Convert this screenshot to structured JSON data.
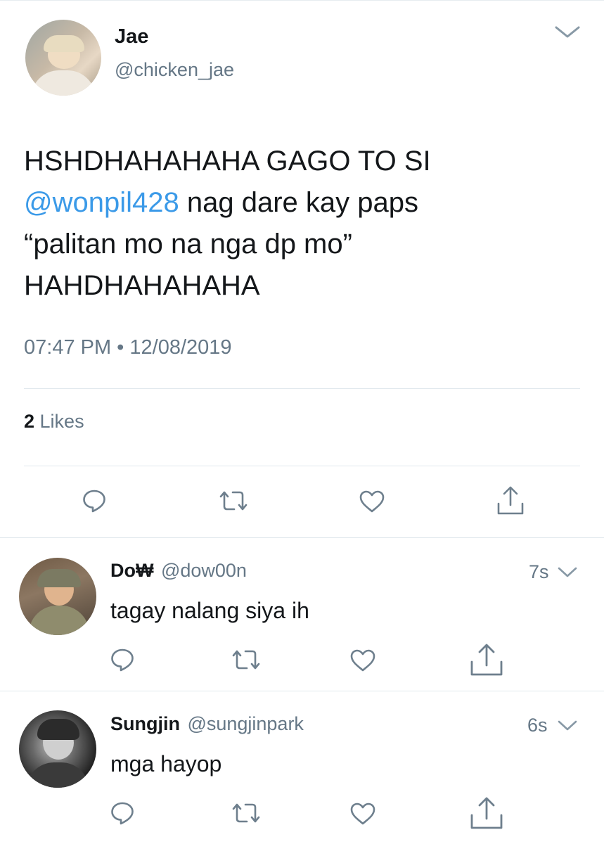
{
  "tweet": {
    "author_name": "Jae",
    "author_handle": "@chicken_jae",
    "text_line1": "HSHDHAHAHAHA GAGO TO SI",
    "mention": "@wonpil428",
    "text_line2_rest": " nag dare kay paps",
    "text_line3": "“palitan mo na nga dp mo”",
    "text_line4": "HAHDHAHAHAHA",
    "timestamp": "07:47 PM • 12/08/2019",
    "likes_count": "2",
    "likes_label": " Likes"
  },
  "replies": [
    {
      "name": "Do₩",
      "handle": "@dow00n",
      "time": "7s",
      "text": "tagay nalang siya ih"
    },
    {
      "name": "Sungjin",
      "handle": "@sungjinpark",
      "time": "6s",
      "text": "mga hayop"
    }
  ],
  "icons": {
    "reply": "speech-bubble-icon",
    "retweet": "retweet-icon",
    "like": "heart-icon",
    "share": "share-icon",
    "more": "chevron-down-icon"
  },
  "colors": {
    "link": "#3b9ae8",
    "gray": "#657786",
    "icon": "#6e7f8d",
    "divider": "#e1e8ed"
  }
}
